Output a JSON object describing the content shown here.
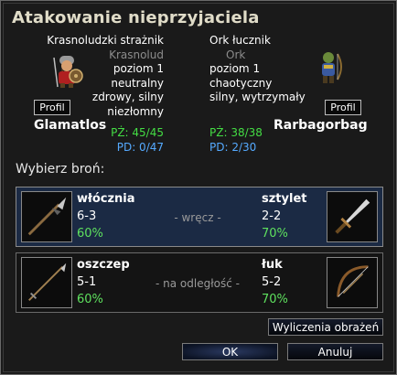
{
  "title": "Atakowanie nieprzyjaciela",
  "attacker": {
    "type": "Krasnoludzki strażnik",
    "race": "Krasnolud",
    "level": "poziom 1",
    "alignment": "neutralny",
    "traits_1": "zdrowy, silny",
    "traits_2": "niezłomny",
    "hp": "PŻ: 45/45",
    "xp": "PD: 0/47",
    "name": "Glamatlos",
    "profile_label": "Profil"
  },
  "defender": {
    "type": "Ork łucznik",
    "race": "Ork",
    "level": "poziom 1",
    "alignment": "chaotyczny",
    "traits_1": "silny, wytrzymały",
    "hp": "PŻ: 38/38",
    "xp": "PD: 2/30",
    "name": "Rarbagorbag",
    "profile_label": "Profil"
  },
  "choose_weapon_label": "Wybierz broń:",
  "attacks": [
    {
      "selected": true,
      "my_weapon": "włócznia",
      "my_damage": "6-3",
      "my_chance": "60%",
      "range": "- wręcz -",
      "enemy_weapon": "sztylet",
      "enemy_damage": "2-2",
      "enemy_chance": "70%",
      "my_icon": "spear-icon",
      "enemy_icon": "dagger-icon"
    },
    {
      "selected": false,
      "my_weapon": "oszczep",
      "my_damage": "5-1",
      "my_chance": "60%",
      "range": "- na odległość -",
      "enemy_weapon": "łuk",
      "enemy_damage": "5-2",
      "enemy_chance": "70%",
      "my_icon": "javelin-icon",
      "enemy_icon": "bow-icon"
    }
  ],
  "buttons": {
    "damage_calc": "Wyliczenia obrażeń",
    "ok": "OK",
    "cancel": "Anuluj"
  }
}
